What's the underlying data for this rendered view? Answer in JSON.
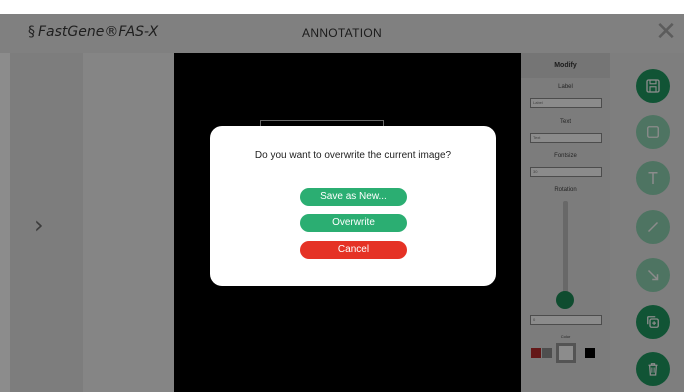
{
  "titlebar": {
    "logo_text": "FastGene®FAS-X",
    "logo_mark": "§",
    "title": "ANNOTATION",
    "close_glyph": "✕"
  },
  "nav": {
    "next_glyph": "›"
  },
  "modify_panel": {
    "header": "Modify",
    "label_heading": "Label",
    "label_placeholder": "Label",
    "text_heading": "Text",
    "text_value": "Text",
    "fontsize_heading": "Fontsize",
    "fontsize_value": "30",
    "rotation_heading": "Rotation",
    "rotation_value": "0",
    "color_heading": "Color",
    "colors": [
      "#b62a2a",
      "#8e8e8e",
      "#ffffff",
      "#000000"
    ]
  },
  "tools": [
    {
      "icon": "save-icon",
      "active": true
    },
    {
      "icon": "rectangle-icon",
      "active": false
    },
    {
      "icon": "text-icon",
      "active": false
    },
    {
      "icon": "line-icon",
      "active": false
    },
    {
      "icon": "arrow-icon",
      "active": false
    },
    {
      "icon": "duplicate-icon",
      "active": true
    },
    {
      "icon": "trash-icon",
      "active": true
    }
  ],
  "dialog": {
    "message": "Do you want to overwrite the current image?",
    "save_as_new": "Save as New...",
    "overwrite": "Overwrite",
    "cancel": "Cancel",
    "accent_color": "#2bae72",
    "cancel_color": "#e53225"
  }
}
